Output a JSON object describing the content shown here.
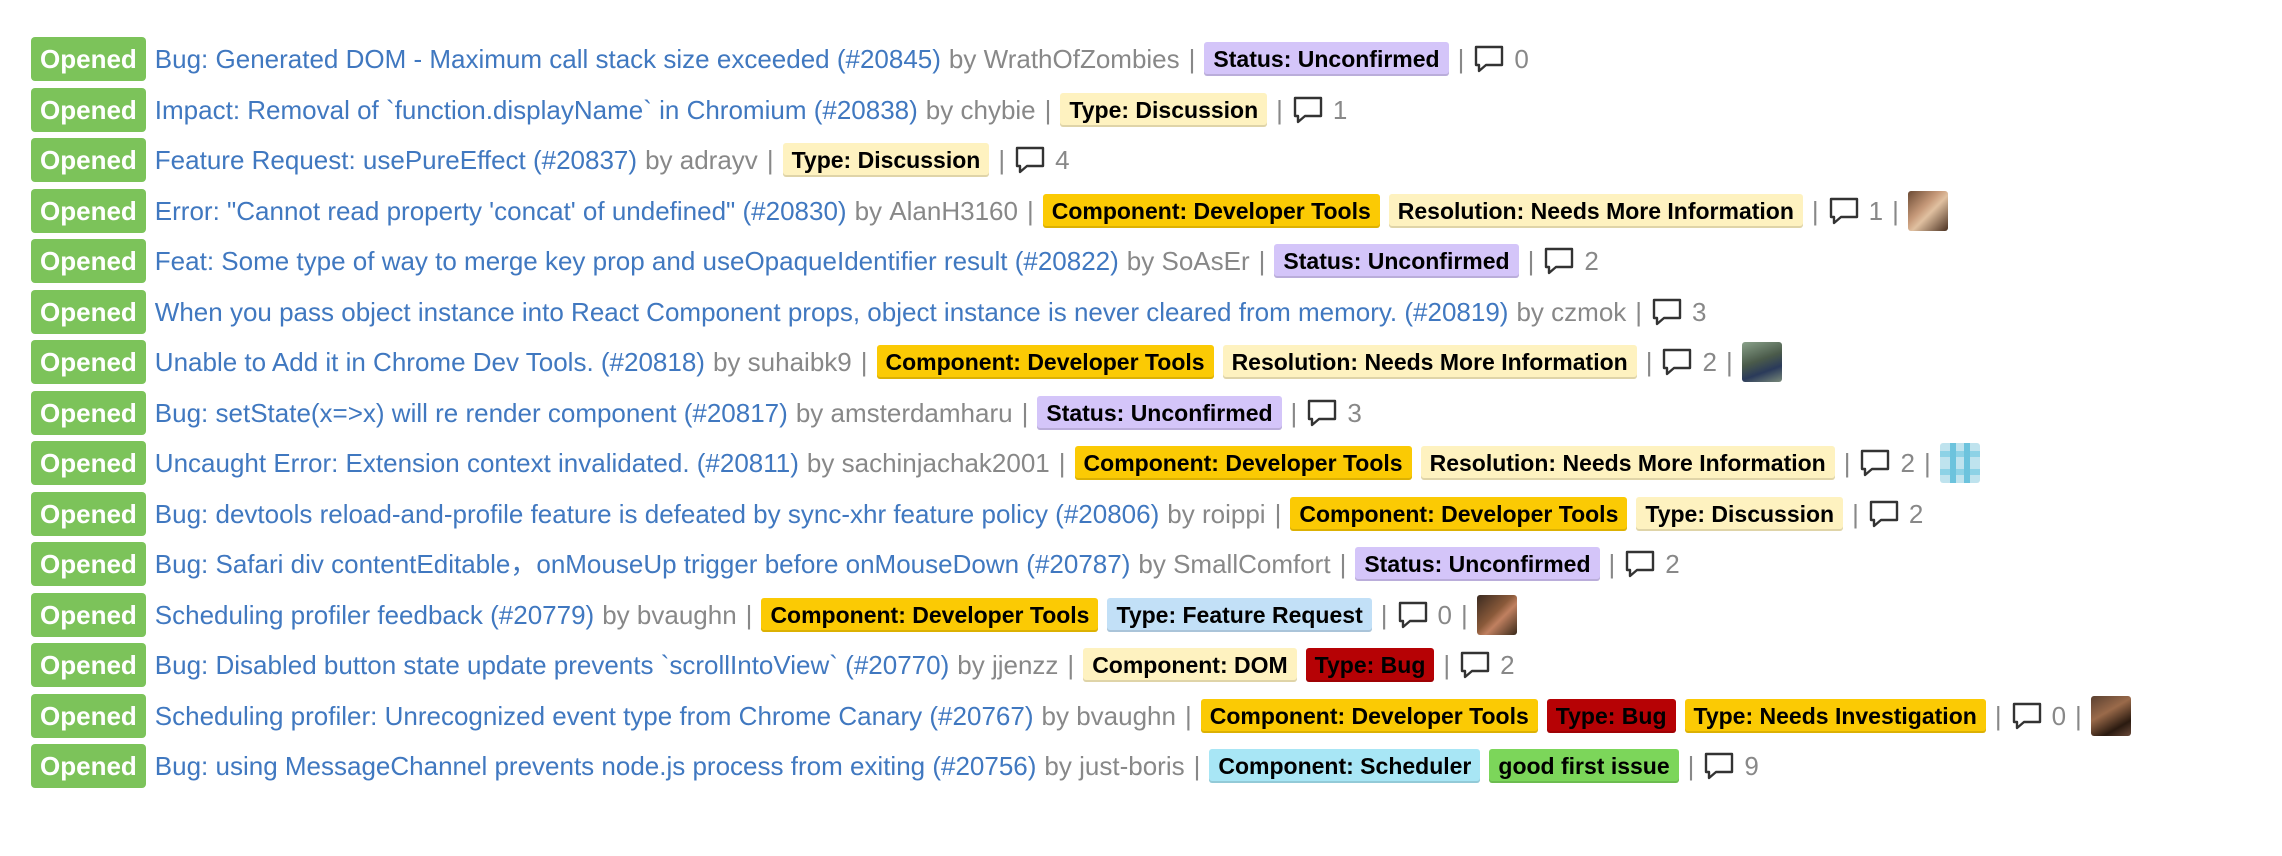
{
  "issues": [
    {
      "status": "Opened",
      "title": "Bug: Generated DOM - Maximum call stack size exceeded (#20845)",
      "by": "by",
      "author": "WrathOfZombies",
      "labels": [
        {
          "text": "Status: Unconfirmed",
          "bg": "#d4c5f9",
          "fg": "#000000"
        }
      ],
      "comments": "0",
      "avatar": null
    },
    {
      "status": "Opened",
      "title": "Impact: Removal of `function.displayName` in Chromium (#20838)",
      "by": "by",
      "author": "chybie",
      "labels": [
        {
          "text": "Type: Discussion",
          "bg": "#fef2c0",
          "fg": "#000000"
        }
      ],
      "comments": "1",
      "avatar": null
    },
    {
      "status": "Opened",
      "title": "Feature Request: usePureEffect (#20837)",
      "by": "by",
      "author": "adrayv",
      "labels": [
        {
          "text": "Type: Discussion",
          "bg": "#fef2c0",
          "fg": "#000000"
        }
      ],
      "comments": "4",
      "avatar": null
    },
    {
      "status": "Opened",
      "title": "Error: \"Cannot read property 'concat' of undefined\" (#20830)",
      "by": "by",
      "author": "AlanH3160",
      "labels": [
        {
          "text": "Component: Developer Tools",
          "bg": "#fbca04",
          "fg": "#000000"
        },
        {
          "text": "Resolution: Needs More Information",
          "bg": "#fef2c0",
          "fg": "#000000"
        }
      ],
      "comments": "1",
      "avatar": "av-0"
    },
    {
      "status": "Opened",
      "title": "Feat: Some type of way to merge key prop and useOpaqueIdentifier result (#20822)",
      "by": "by",
      "author": "SoAsEr",
      "labels": [
        {
          "text": "Status: Unconfirmed",
          "bg": "#d4c5f9",
          "fg": "#000000"
        }
      ],
      "comments": "2",
      "avatar": null
    },
    {
      "status": "Opened",
      "title": "When you pass object instance into React Component props, object instance is never cleared from memory. (#20819)",
      "by": "by",
      "author": "czmok",
      "labels": [],
      "comments": "3",
      "avatar": null
    },
    {
      "status": "Opened",
      "title": "Unable to Add it in Chrome Dev Tools. (#20818)",
      "by": "by",
      "author": "suhaibk9",
      "labels": [
        {
          "text": "Component: Developer Tools",
          "bg": "#fbca04",
          "fg": "#000000"
        },
        {
          "text": "Resolution: Needs More Information",
          "bg": "#fef2c0",
          "fg": "#000000"
        }
      ],
      "comments": "2",
      "avatar": "av-1"
    },
    {
      "status": "Opened",
      "title": "Bug: setState(x=>x) will re render component (#20817)",
      "by": "by",
      "author": "amsterdamharu",
      "labels": [
        {
          "text": "Status: Unconfirmed",
          "bg": "#d4c5f9",
          "fg": "#000000"
        }
      ],
      "comments": "3",
      "avatar": null
    },
    {
      "status": "Opened",
      "title": "Uncaught Error: Extension context invalidated. (#20811)",
      "by": "by",
      "author": "sachinjachak2001",
      "labels": [
        {
          "text": "Component: Developer Tools",
          "bg": "#fbca04",
          "fg": "#000000"
        },
        {
          "text": "Resolution: Needs More Information",
          "bg": "#fef2c0",
          "fg": "#000000"
        }
      ],
      "comments": "2",
      "avatar": "av-2"
    },
    {
      "status": "Opened",
      "title": "Bug: devtools reload-and-profile feature is defeated by sync-xhr feature policy (#20806)",
      "by": "by",
      "author": "roippi",
      "labels": [
        {
          "text": "Component: Developer Tools",
          "bg": "#fbca04",
          "fg": "#000000"
        },
        {
          "text": "Type: Discussion",
          "bg": "#fef2c0",
          "fg": "#000000"
        }
      ],
      "comments": "2",
      "avatar": null
    },
    {
      "status": "Opened",
      "title": "Bug: Safari div contentEditable，onMouseUp trigger before onMouseDown (#20787)",
      "by": "by",
      "author": "SmallComfort",
      "labels": [
        {
          "text": "Status: Unconfirmed",
          "bg": "#d4c5f9",
          "fg": "#000000"
        }
      ],
      "comments": "2",
      "avatar": null
    },
    {
      "status": "Opened",
      "title": "Scheduling profiler feedback (#20779)",
      "by": "by",
      "author": "bvaughn",
      "labels": [
        {
          "text": "Component: Developer Tools",
          "bg": "#fbca04",
          "fg": "#000000"
        },
        {
          "text": "Type: Feature Request",
          "bg": "#c2e0f7",
          "fg": "#000000"
        }
      ],
      "comments": "0",
      "avatar": "av-3"
    },
    {
      "status": "Opened",
      "title": "Bug: Disabled button state update prevents `scrollIntoView` (#20770)",
      "by": "by",
      "author": "jjenzz",
      "labels": [
        {
          "text": "Component: DOM",
          "bg": "#fef2c0",
          "fg": "#000000"
        },
        {
          "text": "Type: Bug",
          "bg": "#b60205",
          "fg": "#000000"
        }
      ],
      "comments": "2",
      "avatar": null
    },
    {
      "status": "Opened",
      "title": "Scheduling profiler: Unrecognized event type from Chrome Canary (#20767)",
      "by": "by",
      "author": "bvaughn",
      "labels": [
        {
          "text": "Component: Developer Tools",
          "bg": "#fbca04",
          "fg": "#000000"
        },
        {
          "text": "Type: Bug",
          "bg": "#b60205",
          "fg": "#000000"
        },
        {
          "text": "Type: Needs Investigation",
          "bg": "#fbca04",
          "fg": "#000000"
        }
      ],
      "comments": "0",
      "avatar": "av-4"
    },
    {
      "status": "Opened",
      "title": "Bug: using MessageChannel prevents node.js process from exiting (#20756)",
      "by": "by",
      "author": "just-boris",
      "labels": [
        {
          "text": "Component: Scheduler",
          "bg": "#a8e6f5",
          "fg": "#000000"
        },
        {
          "text": "good first issue",
          "bg": "#7cd65a",
          "fg": "#000000"
        }
      ],
      "comments": "9",
      "avatar": null
    }
  ],
  "separator": "|",
  "icons": {
    "comment": "comment-icon",
    "avatar": "avatar"
  },
  "colors": {
    "opened_badge": "#7cc35a",
    "link": "#4078c0",
    "muted": "#888888"
  }
}
